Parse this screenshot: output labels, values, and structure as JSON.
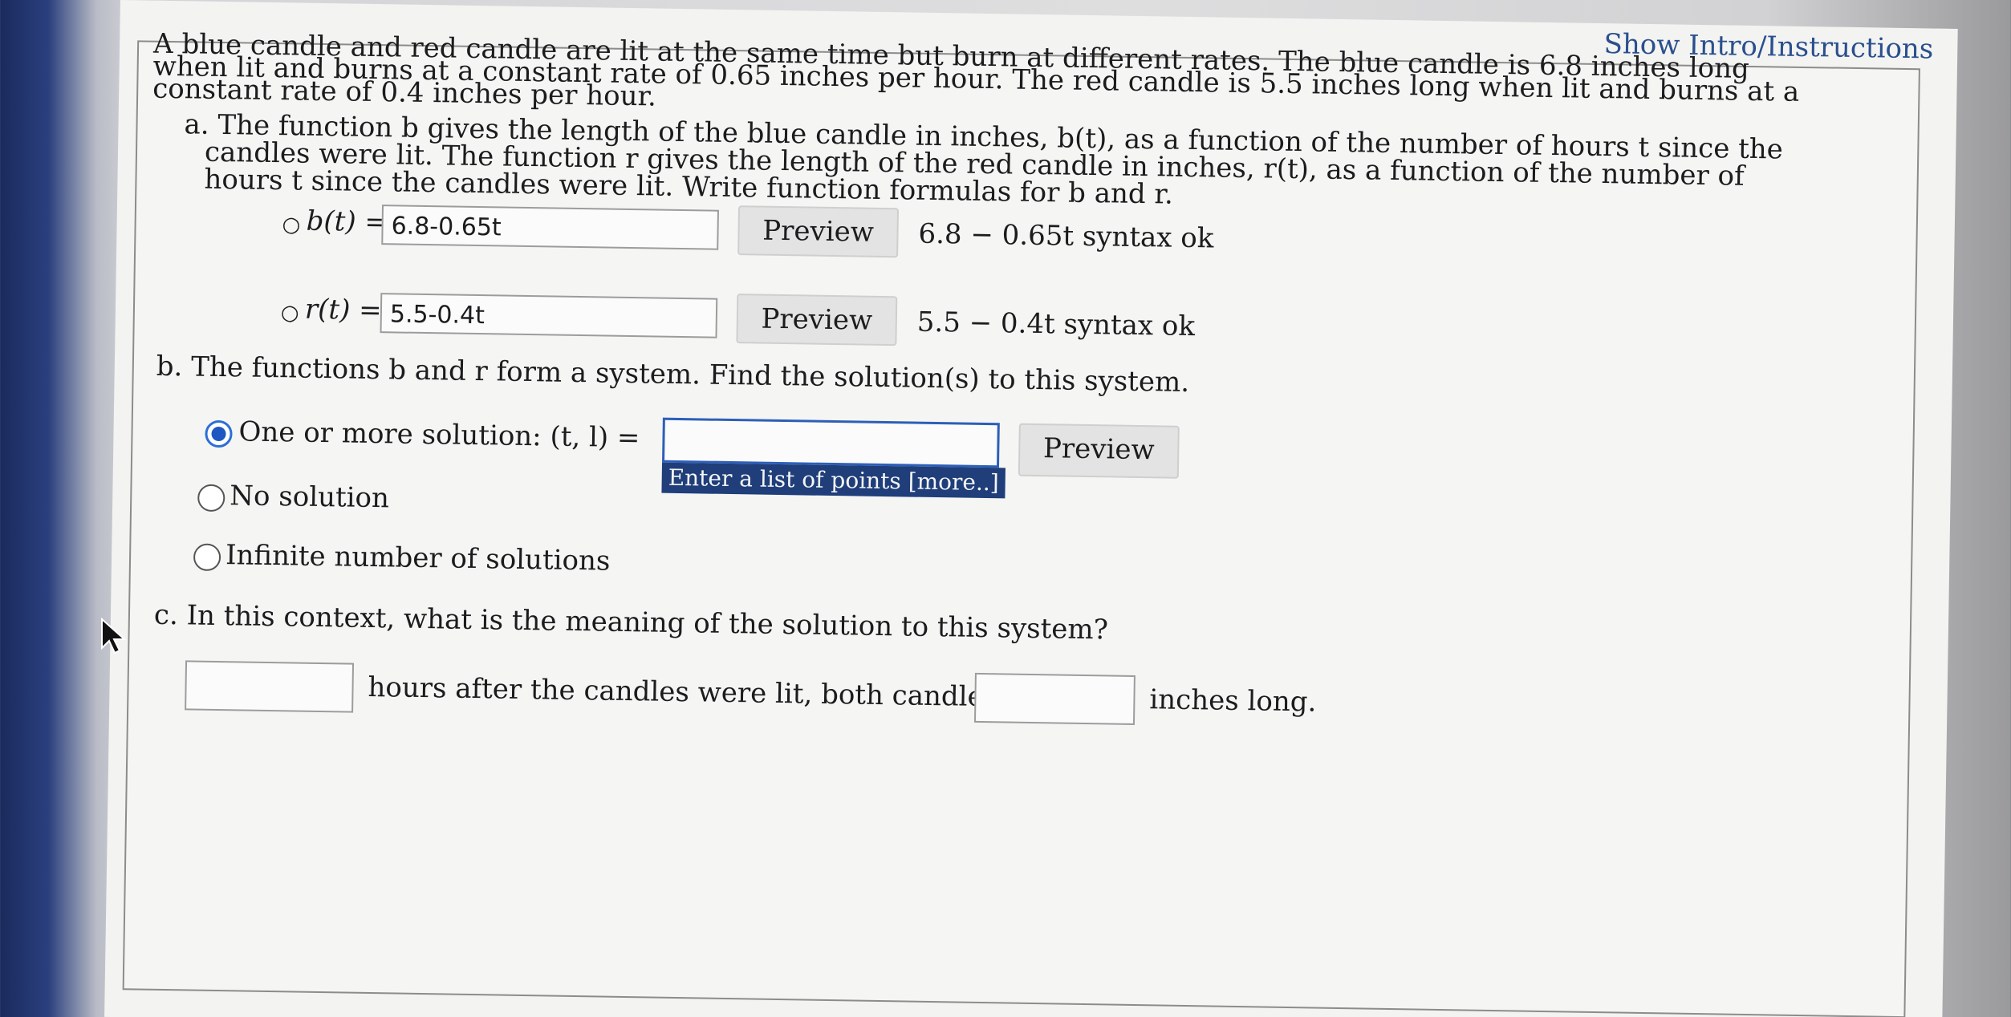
{
  "header": {
    "intro_link": "Show Intro/Instructions"
  },
  "problem": {
    "line1": "A blue candle and red candle are lit at the same time but burn at different rates. The blue candle is 6.8 inches long",
    "line2": "when lit and burns at a constant rate of 0.65 inches per hour. The red candle is 5.5 inches long when lit and burns at a",
    "line3": "constant rate of 0.4 inches per hour."
  },
  "part_a": {
    "line1": "a. The function b gives the length of the blue candle in inches, b(t), as a function of the number of hours t since the",
    "line2": "candles were lit. The function r gives the length of the red candle in inches, r(t), as a function of the number of",
    "line3": "hours t since the candles were lit. Write function formulas for b and r.",
    "b_label": "b(t) =",
    "b_value": "6.8-0.65t",
    "b_preview": "6.8 − 0.65t syntax ok",
    "r_label": "r(t) =",
    "r_value": "5.5-0.4t",
    "r_preview": "5.5 − 0.4t syntax ok",
    "preview_label": "Preview"
  },
  "part_b": {
    "question": "b. The functions b and r form a system. Find the solution(s) to this system.",
    "option_one": "One or more solution: (t, l) =",
    "option_none": "No solution",
    "option_infinite": "Infinite number of solutions",
    "answer_value": "",
    "preview_label": "Preview",
    "tooltip": "Enter a list of points [more..]"
  },
  "part_c": {
    "question": "c. In this context, what is the meaning of the solution to this system?",
    "hours_value": "",
    "mid_text": "hours after the candles were lit, both candles are",
    "inches_value": "",
    "end_text": "inches long."
  }
}
